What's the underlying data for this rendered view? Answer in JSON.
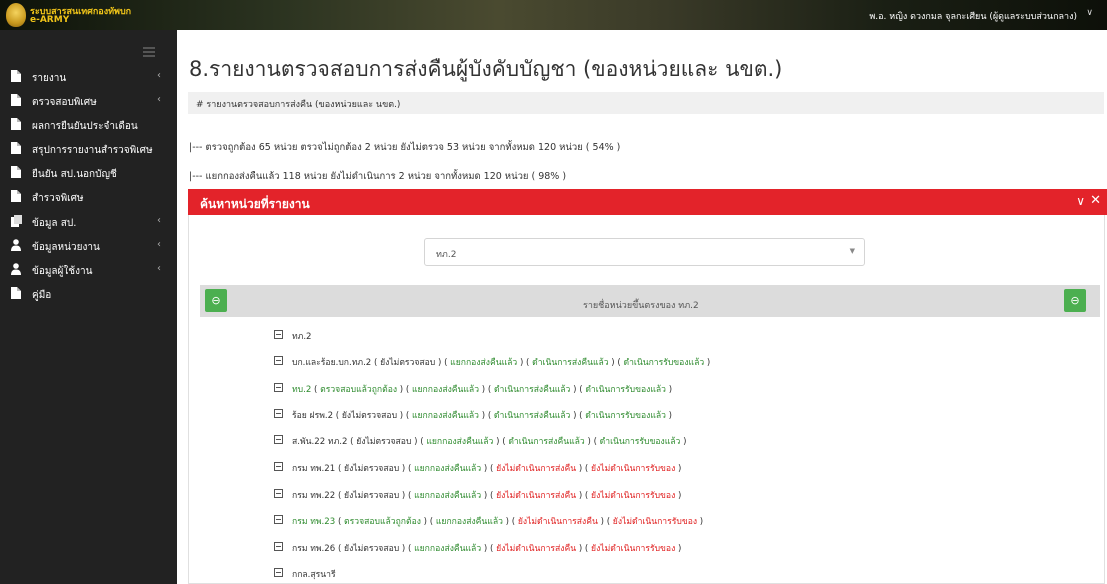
{
  "header": {
    "brand_line1": "ระบบสารสนเทศกองทัพบก",
    "brand_line2": "e-ARMY",
    "user": "พ.อ. หญิง ดวงกมล จุลกะเศียน (ผู้ดูแลระบบส่วนกลาง)",
    "user_caret": "∨"
  },
  "sidebar": {
    "items": [
      {
        "label": "รายงาน",
        "icon": "document-icon",
        "chevron": "‹"
      },
      {
        "label": "ตรวจสอบพิเศษ",
        "icon": "document-icon",
        "chevron": "‹"
      },
      {
        "label": "ผลการยืนยันประจำเดือน",
        "icon": "document-icon",
        "chevron": ""
      },
      {
        "label": "สรุปการรายงานสำรวจพิเศษ",
        "icon": "document-icon",
        "chevron": ""
      },
      {
        "label": "ยืนยัน สป.นอกบัญชี",
        "icon": "document-icon",
        "chevron": ""
      },
      {
        "label": "สำรวจพิเศษ",
        "icon": "document-icon",
        "chevron": ""
      },
      {
        "label": "ข้อมูล สป.",
        "icon": "copy-icon",
        "chevron": "‹"
      },
      {
        "label": "ข้อมูลหน่วยงาน",
        "icon": "user-icon",
        "chevron": "‹"
      },
      {
        "label": "ข้อมูลผู้ใช้งาน",
        "icon": "user-icon",
        "chevron": "‹"
      },
      {
        "label": "คู่มือ",
        "icon": "document-icon",
        "chevron": ""
      }
    ]
  },
  "main": {
    "title": "8.รายงานตรวจสอบการส่งคืนผู้บังคับบัญชา (ของหน่วยและ นขต.)",
    "breadcrumb": "# รายงานตรวจสอบการส่งคืน (ของหน่วยและ นขต.)",
    "summary1": "|--- ตรวจถูกต้อง 65 หน่วย ตรวจไม่ถูกต้อง 2 หน่วย ยังไม่ตรวจ 53 หน่วย จากทั้งหมด 120 หน่วย ( 54% )",
    "summary2": "|--- แยกกองส่งคืนแล้ว 118 หน่วย ยังไม่ดำเนินการ 2 หน่วย จากทั้งหมด 120 หน่วย ( 98% )"
  },
  "panel": {
    "title": "ค้นหาหน่วยที่รายงาน",
    "collapse": "∨",
    "close": "✕",
    "select_value": "ทภ.2",
    "select_arrow": "▼",
    "list_title": "รายชื่อหน่วยขึ้นตรงของ ทภ.2",
    "left_btn": "⊖",
    "right_btn": "⊖"
  },
  "tree": [
    {
      "unit": "ทภ.2",
      "cls": "k",
      "parts": []
    },
    {
      "unit": "บก.และร้อย.บก.ทภ.2",
      "cls": "k",
      "parts": [
        {
          "t": "ยังไม่ตรวจสอบ",
          "c": "k"
        },
        {
          "t": "แยกกองส่งคืนแล้ว",
          "c": "g"
        },
        {
          "t": "ดำเนินการส่งคืนแล้ว",
          "c": "g"
        },
        {
          "t": "ดำเนินการรับของแล้ว",
          "c": "g"
        }
      ]
    },
    {
      "unit": "ทบ.2",
      "cls": "g",
      "parts": [
        {
          "t": "ตรวจสอบแล้วถูกต้อง",
          "c": "g"
        },
        {
          "t": "แยกกองส่งคืนแล้ว",
          "c": "g"
        },
        {
          "t": "ดำเนินการส่งคืนแล้ว",
          "c": "g"
        },
        {
          "t": "ดำเนินการรับของแล้ว",
          "c": "g"
        }
      ]
    },
    {
      "unit": "ร้อย ฝรพ.2",
      "cls": "k",
      "parts": [
        {
          "t": "ยังไม่ตรวจสอบ",
          "c": "k"
        },
        {
          "t": "แยกกองส่งคืนแล้ว",
          "c": "g"
        },
        {
          "t": "ดำเนินการส่งคืนแล้ว",
          "c": "g"
        },
        {
          "t": "ดำเนินการรับของแล้ว",
          "c": "g"
        }
      ]
    },
    {
      "unit": "ส.พัน.22 ทภ.2",
      "cls": "k",
      "parts": [
        {
          "t": "ยังไม่ตรวจสอบ",
          "c": "k"
        },
        {
          "t": "แยกกองส่งคืนแล้ว",
          "c": "g"
        },
        {
          "t": "ดำเนินการส่งคืนแล้ว",
          "c": "g"
        },
        {
          "t": "ดำเนินการรับของแล้ว",
          "c": "g"
        }
      ]
    },
    {
      "unit": "กรม ทพ.21",
      "cls": "k",
      "parts": [
        {
          "t": "ยังไม่ตรวจสอบ",
          "c": "k"
        },
        {
          "t": "แยกกองส่งคืนแล้ว",
          "c": "g"
        },
        {
          "t": "ยังไม่ดำเนินการส่งคืน",
          "c": "r"
        },
        {
          "t": "ยังไม่ดำเนินการรับของ",
          "c": "r"
        }
      ]
    },
    {
      "unit": "กรม ทพ.22",
      "cls": "k",
      "parts": [
        {
          "t": "ยังไม่ตรวจสอบ",
          "c": "k"
        },
        {
          "t": "แยกกองส่งคืนแล้ว",
          "c": "g"
        },
        {
          "t": "ยังไม่ดำเนินการส่งคืน",
          "c": "r"
        },
        {
          "t": "ยังไม่ดำเนินการรับของ",
          "c": "r"
        }
      ]
    },
    {
      "unit": "กรม ทพ.23",
      "cls": "g",
      "parts": [
        {
          "t": "ตรวจสอบแล้วถูกต้อง",
          "c": "g"
        },
        {
          "t": "แยกกองส่งคืนแล้ว",
          "c": "g"
        },
        {
          "t": "ยังไม่ดำเนินการส่งคืน",
          "c": "r"
        },
        {
          "t": "ยังไม่ดำเนินการรับของ",
          "c": "r"
        }
      ]
    },
    {
      "unit": "กรม ทพ.26",
      "cls": "k",
      "parts": [
        {
          "t": "ยังไม่ตรวจสอบ",
          "c": "k"
        },
        {
          "t": "แยกกองส่งคืนแล้ว",
          "c": "g"
        },
        {
          "t": "ยังไม่ดำเนินการส่งคืน",
          "c": "r"
        },
        {
          "t": "ยังไม่ดำเนินการรับของ",
          "c": "r"
        }
      ]
    },
    {
      "unit": "กกล.สุรนารี",
      "cls": "k",
      "parts": []
    }
  ]
}
